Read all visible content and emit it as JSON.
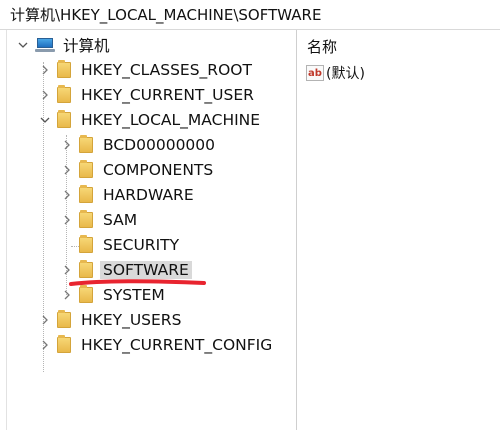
{
  "address_bar": {
    "path": "计算机\\HKEY_LOCAL_MACHINE\\SOFTWARE"
  },
  "tree": {
    "root": {
      "label": "计算机",
      "icon": "computer-icon",
      "expanded": true
    },
    "hives": [
      {
        "label": "HKEY_CLASSES_ROOT",
        "expanded": false
      },
      {
        "label": "HKEY_CURRENT_USER",
        "expanded": false
      },
      {
        "label": "HKEY_LOCAL_MACHINE",
        "expanded": true,
        "children": [
          {
            "label": "BCD00000000",
            "expandable": true
          },
          {
            "label": "COMPONENTS",
            "expandable": true
          },
          {
            "label": "HARDWARE",
            "expandable": true
          },
          {
            "label": "SAM",
            "expandable": true
          },
          {
            "label": "SECURITY",
            "expandable": false
          },
          {
            "label": "SOFTWARE",
            "expandable": true,
            "selected": true
          },
          {
            "label": "SYSTEM",
            "expandable": true
          }
        ]
      },
      {
        "label": "HKEY_USERS",
        "expanded": false
      },
      {
        "label": "HKEY_CURRENT_CONFIG",
        "expanded": false
      }
    ]
  },
  "values_pane": {
    "column_header": "名称",
    "rows": [
      {
        "icon": "string-value-icon",
        "icon_text": "ab",
        "name": "(默认)"
      }
    ]
  },
  "colors": {
    "selection_bg": "#d9d9d9",
    "annotation_underline": "#e8242f",
    "folder": "#f0c75e"
  }
}
